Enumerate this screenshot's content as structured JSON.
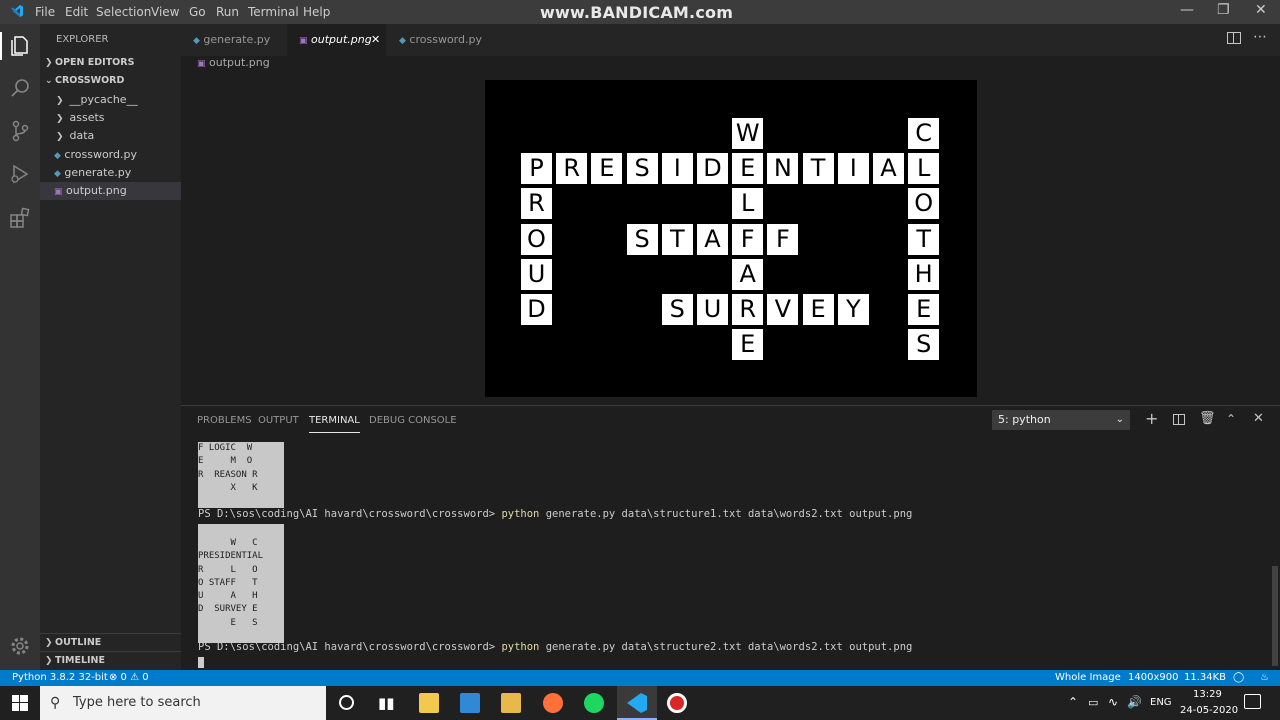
{
  "titlebar": {
    "menu": [
      "File",
      "Edit",
      "Selection",
      "View",
      "Go",
      "Run",
      "Terminal",
      "Help"
    ],
    "watermark": "www.BANDICAM.com"
  },
  "sidebar": {
    "header": "EXPLORER",
    "open_editors": "OPEN EDITORS",
    "folder": "CROSSWORD",
    "items": [
      {
        "label": "__pycache__",
        "type": "folder"
      },
      {
        "label": "assets",
        "type": "folder"
      },
      {
        "label": "data",
        "type": "folder"
      },
      {
        "label": "crossword.py",
        "type": "file"
      },
      {
        "label": "generate.py",
        "type": "file"
      },
      {
        "label": "output.png",
        "type": "image"
      }
    ],
    "outline": "OUTLINE",
    "timeline": "TIMELINE"
  },
  "tabs": [
    {
      "label": "generate.py",
      "active": false
    },
    {
      "label": "output.png",
      "active": true
    },
    {
      "label": "crossword.py",
      "active": false
    }
  ],
  "breadcrumb": "output.png",
  "crossword": {
    "words": [
      "PRESIDENTIAL",
      "STAFF",
      "SURVEY",
      "PROUD",
      "WELFARE",
      "CLOTHES"
    ]
  },
  "panel": {
    "tabs": [
      "PROBLEMS",
      "OUTPUT",
      "TERMINAL",
      "DEBUG CONSOLE"
    ],
    "terminal_select": "5: python",
    "prev_grid": [
      "F LOGIC  W",
      "E     M  O",
      "R  REASON R",
      "      X   K"
    ],
    "prompt1": "PS D:\\sos\\coding\\AI havard\\crossword\\crossword> ",
    "cmd1_py": "python",
    "cmd1_args": " generate.py data\\structure1.txt data\\words2.txt output.png",
    "grid2": [
      "      W   C",
      "PRESIDENTIAL",
      "R     L   O",
      "O STAFF   T",
      "U     A   H",
      "D  SURVEY E",
      "      E   S"
    ],
    "prompt2": "PS D:\\sos\\coding\\AI havard\\crossword\\crossword> ",
    "cmd2_py": "python",
    "cmd2_args": " generate.py data\\structure2.txt data\\words2.txt output.png"
  },
  "status": {
    "python": "Python 3.8.2 32-bit",
    "problems": "⊗ 0 ⚠ 0",
    "whole_image": "Whole Image",
    "dims": "1400x900",
    "size": "11.34KB"
  },
  "taskbar": {
    "search_placeholder": "Type here to search",
    "lang": "ENG",
    "time": "13:29",
    "date": "24-05-2020"
  },
  "colors": {
    "accent": "#007acc",
    "python_kw": "#dcdcaa"
  }
}
